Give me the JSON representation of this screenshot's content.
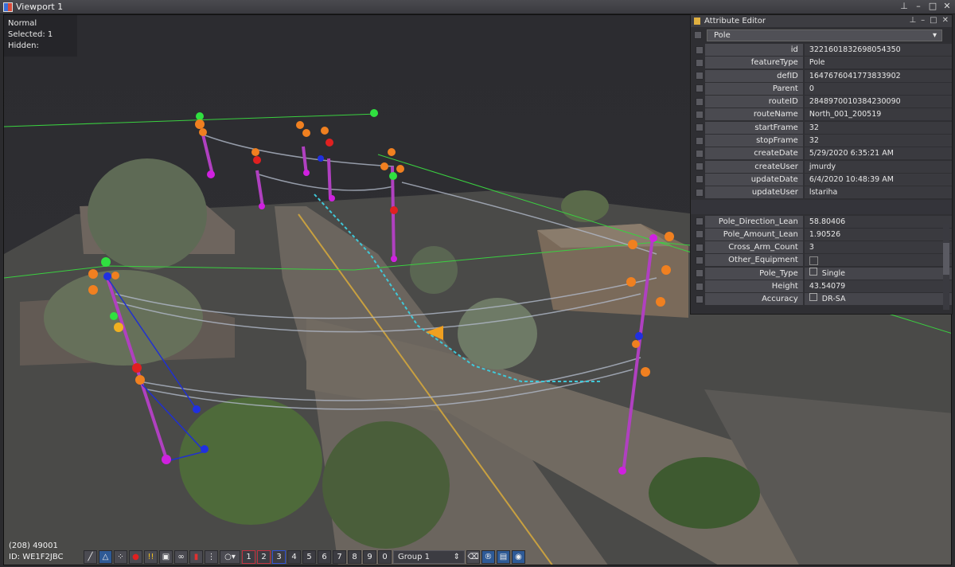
{
  "window": {
    "title": "Viewport 1"
  },
  "info": {
    "mode": "Normal",
    "selected": "Selected: 1",
    "hidden": "Hidden:"
  },
  "status": {
    "count": "(208) 49001",
    "id": "ID: WE1F2JBC"
  },
  "toolbar": {
    "numbers": [
      "1",
      "2",
      "3",
      "4",
      "5",
      "6",
      "7",
      "8",
      "9",
      "0"
    ],
    "group": "Group 1"
  },
  "attribute_editor": {
    "title": "Attribute Editor",
    "feature_type": "Pole",
    "rows": [
      {
        "label": "id",
        "value": "3221601832698054350"
      },
      {
        "label": "featureType",
        "value": "Pole"
      },
      {
        "label": "defID",
        "value": "1647676041773833902"
      },
      {
        "label": "Parent",
        "value": "0"
      },
      {
        "label": "routeID",
        "value": "2848970010384230090"
      },
      {
        "label": "routeName",
        "value": "North_001_200519"
      },
      {
        "label": "startFrame",
        "value": "32"
      },
      {
        "label": "stopFrame",
        "value": "32"
      },
      {
        "label": "createDate",
        "value": "5/29/2020 6:35:21 AM"
      },
      {
        "label": "createUser",
        "value": "jmurdy"
      },
      {
        "label": "updateDate",
        "value": "6/4/2020 10:48:39 AM"
      },
      {
        "label": "updateUser",
        "value": "lstariha"
      }
    ],
    "custom": [
      {
        "label": "Pole_Direction_Lean",
        "value": "58.80406"
      },
      {
        "label": "Pole_Amount_Lean",
        "value": "1.90526"
      },
      {
        "label": "Cross_Arm_Count",
        "value": "3"
      },
      {
        "label": "Other_Equipment",
        "value": ""
      },
      {
        "label": "Pole_Type",
        "value": "Single"
      },
      {
        "label": "Height",
        "value": "43.54079"
      },
      {
        "label": "Accuracy",
        "value": "DR-SA"
      }
    ]
  }
}
